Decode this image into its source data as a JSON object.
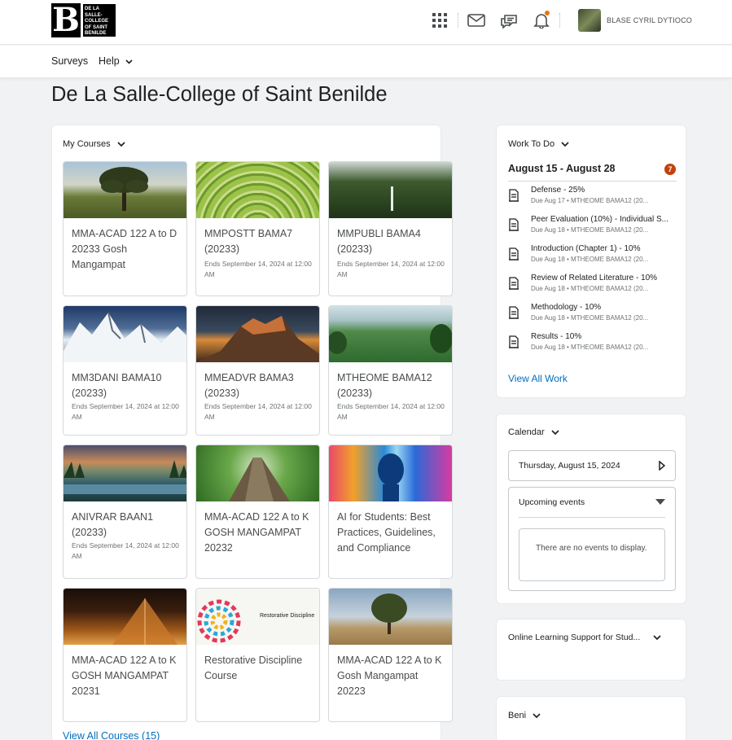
{
  "header": {
    "logo_text": "DE LA SALLE- COLLEGE OF SAINT BENILDE",
    "logo_letter": "B",
    "user_name": "BLASE CYRIL DYTIOCO",
    "icons": [
      "apps-grid-icon",
      "mail-icon",
      "chat-icon",
      "bell-icon"
    ]
  },
  "nav": {
    "items": [
      {
        "label": "Surveys"
      },
      {
        "label": "Help"
      }
    ]
  },
  "page_title": "De La Salle-College of Saint Benilde",
  "my_courses": {
    "heading": "My Courses",
    "view_all": "View All Courses (15)",
    "courses": [
      {
        "name": "MMA-ACAD 122 A to D 20233 Gosh Mangampat",
        "ends": ""
      },
      {
        "name": "MMPOSTT BAMA7 (20233)",
        "ends": "Ends September 14, 2024 at 12:00 AM"
      },
      {
        "name": "MMPUBLI BAMA4 (20233)",
        "ends": "Ends September 14, 2024 at 12:00 AM"
      },
      {
        "name": "MM3DANI BAMA10 (20233)",
        "ends": "Ends September 14, 2024 at 12:00 AM"
      },
      {
        "name": "MMEADVR BAMA3 (20233)",
        "ends": "Ends September 14, 2024 at 12:00 AM"
      },
      {
        "name": "MTHEOME BAMA12 (20233)",
        "ends": "Ends September 14, 2024 at 12:00 AM"
      },
      {
        "name": "ANIVRAR BAAN1 (20233)",
        "ends": "Ends September 14, 2024 at 12:00 AM"
      },
      {
        "name": "MMA-ACAD 122 A to K GOSH MANGAMPAT 20232",
        "ends": ""
      },
      {
        "name": "AI for Students: Best Practices, Guidelines, and Compliance",
        "ends": ""
      },
      {
        "name": "MMA-ACAD 122 A to K GOSH MANGAMPAT 20231",
        "ends": ""
      },
      {
        "name": "Restorative Discipline Course",
        "ends": "",
        "image_text": "Restorative Discipline"
      },
      {
        "name": "MMA-ACAD 122 A to K Gosh Mangampat 20223",
        "ends": ""
      }
    ]
  },
  "work_to_do": {
    "heading": "Work To Do",
    "range": "August 15 - August 28",
    "count": "7",
    "view_all": "View All Work",
    "items": [
      {
        "title": "Defense - 25%",
        "due": "Due Aug 17 • MTHEOME BAMA12 (20..."
      },
      {
        "title": "Peer Evaluation (10%) - Individual S...",
        "due": "Due Aug 18 • MTHEOME BAMA12 (20..."
      },
      {
        "title": "Introduction (Chapter 1) - 10%",
        "due": "Due Aug 18 • MTHEOME BAMA12 (20..."
      },
      {
        "title": "Review of Related Literature - 10%",
        "due": "Due Aug 18 • MTHEOME BAMA12 (20..."
      },
      {
        "title": "Methodology - 10%",
        "due": "Due Aug 18 • MTHEOME BAMA12 (20..."
      },
      {
        "title": "Results - 10%",
        "due": "Due Aug 18 • MTHEOME BAMA12 (20..."
      }
    ]
  },
  "calendar": {
    "heading": "Calendar",
    "date": "Thursday, August 15, 2024",
    "upcoming_label": "Upcoming events",
    "no_events": "There are no events to display."
  },
  "online_support": {
    "heading": "Online Learning Support for Stud..."
  },
  "beni": {
    "heading": "Beni"
  },
  "colors": {
    "link": "#006fbf",
    "badge": "#c2410c",
    "notification": "#e87511"
  }
}
